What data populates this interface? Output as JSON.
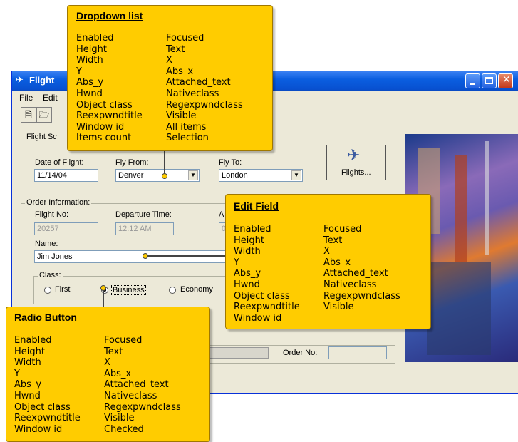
{
  "window": {
    "title": "Flight",
    "menu": [
      "File",
      "Edit"
    ],
    "flight_schedule_label": "Flight Sc",
    "date_label": "Date of Flight:",
    "date_value": "11/14/04",
    "from_label": "Fly From:",
    "from_value": "Denver",
    "to_label": "Fly To:",
    "to_value": "London",
    "flights_button": "Flights...",
    "order_info_label": "Order Information:",
    "flight_no_label": "Flight No:",
    "flight_no_value": "20257",
    "departure_label": "Departure Time:",
    "departure_value": "12:12 AM",
    "arrival_label_partial": "A",
    "arrival_value_partial": "0",
    "name_label": "Name:",
    "name_value": "Jim Jones",
    "class_label": "Class:",
    "class_options": [
      "First",
      "Business",
      "Economy"
    ],
    "class_selected": "Business",
    "order_no_label": "Order No:"
  },
  "callouts": {
    "dropdown": {
      "title": "Dropdown list",
      "left": [
        "Enabled",
        "Height",
        "Width",
        "Y",
        "Abs_y",
        "Hwnd",
        "Object class",
        "Reexpwndtitle",
        "Window id",
        "Items count"
      ],
      "right": [
        "Focused",
        "Text",
        "X",
        "Abs_x",
        "Attached_text",
        "Nativeclass",
        "Regexpwndclass",
        "Visible",
        "All items",
        "Selection"
      ]
    },
    "editfield": {
      "title": "Edit Field",
      "left": [
        "Enabled",
        "Height",
        "Width",
        "Y",
        "Abs_y",
        "Hwnd",
        "Object class",
        "Reexpwndtitle",
        "Window id"
      ],
      "right": [
        "Focused",
        "Text",
        "X",
        "Abs_x",
        "Attached_text",
        "Nativeclass",
        "Regexpwndclass",
        "Visible"
      ]
    },
    "radio": {
      "title": "Radio Button",
      "left": [
        "Enabled",
        "Height",
        "Width",
        "Y",
        "Abs_y",
        "Hwnd",
        "Object class",
        "Reexpwndtitle",
        "Window id"
      ],
      "right": [
        "Focused",
        "Text",
        "X",
        "Abs_x",
        "Attached_text",
        "Nativeclass",
        "Regexpwndclass",
        "Visible",
        "Checked"
      ]
    }
  },
  "colors": {
    "callout_bg": "#ffcc00",
    "titlebar": "#0a5ee0",
    "window_bg": "#ece9d8"
  },
  "icons": [
    "airplane-icon",
    "new-document-icon",
    "open-folder-icon",
    "minimize-icon",
    "maximize-icon",
    "close-icon"
  ]
}
